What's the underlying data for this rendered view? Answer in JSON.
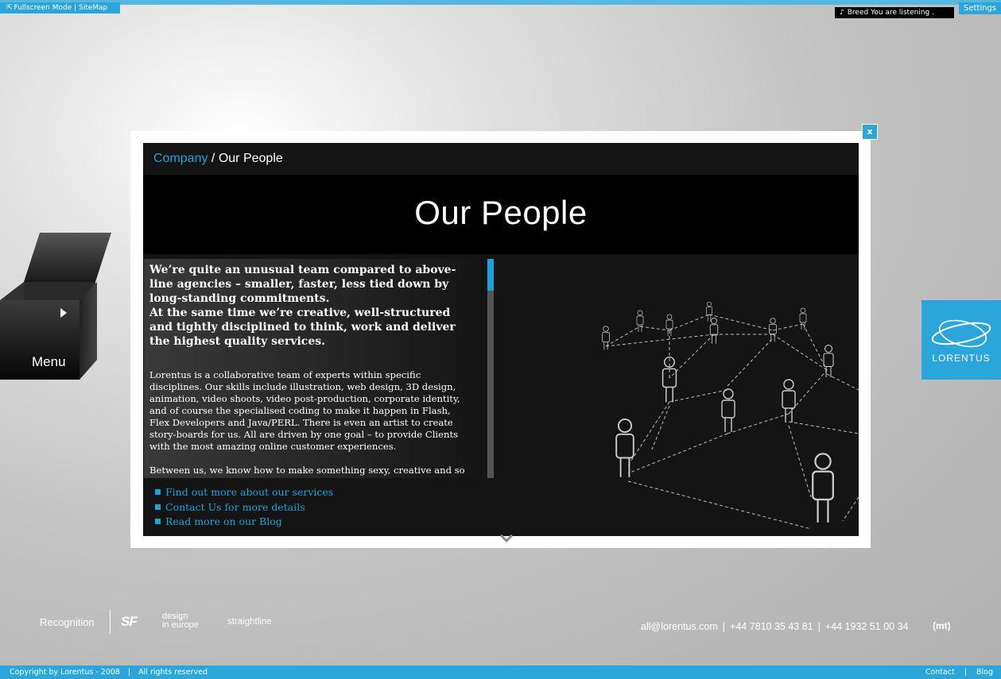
{
  "topbar": {
    "left_text": "Fullscreen Mode | SiteMap",
    "listening_text": "Breed  You are listening .",
    "settings_label": "Settings"
  },
  "menu": {
    "label": "Menu"
  },
  "modal": {
    "close_label": "x",
    "breadcrumb_link": "Company",
    "breadcrumb_sep": " / ",
    "breadcrumb_current": "Our People",
    "title": "Our People",
    "intro": "We’re quite an unusual team compared to above-line agencies – smaller, faster, less tied down by long-standing commitments.\nAt the same time we’re creative, well-structured and tightly disciplined to think, work and deliver the highest quality services.",
    "body1": "Lorentus is a collaborative team of experts within specific disciplines. Our skills include illustration, web design, 3D design, animation, video shoots, video post-production, corporate identity, and of course the specialised coding to make it happen in Flash, Flex Developers and Java/PERL. There is even an artist to create story-boards for us. All are driven by one goal – to provide Clients with the most amazing online customer experiences.",
    "body2": "Between us, we know how to make something sexy, creative and so",
    "links": [
      "Find out more about our services",
      "Contact Us for more details",
      "Read more on our Blog"
    ]
  },
  "logo": {
    "text": "LORENTUS"
  },
  "footer": {
    "recognition": "Recognition",
    "sf": "SF",
    "design_line1": "design",
    "design_line2": "in europe",
    "straightline": "straightline",
    "email": "all@lorentus.com",
    "phone1": "+44 7810 35 43 81",
    "phone2": "+44 1932 51 00 34",
    "mt": "(mt)",
    "copyright": "Copyright by Lorentus - 2008",
    "rights": "All rights reserved",
    "contact_link": "Contact",
    "blog_link": "Blog"
  },
  "colors": {
    "accent": "#2aa6da",
    "link": "#1aa3d9",
    "panel": "#141414"
  }
}
